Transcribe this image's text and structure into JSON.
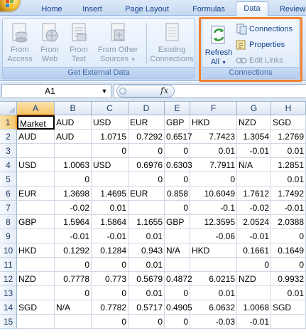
{
  "ribbon": {
    "tabs": [
      {
        "label": "Home",
        "active": false
      },
      {
        "label": "Insert",
        "active": false
      },
      {
        "label": "Page Layout",
        "active": false
      },
      {
        "label": "Formulas",
        "active": false
      },
      {
        "label": "Data",
        "active": true
      },
      {
        "label": "Review",
        "active": false
      }
    ],
    "get_external_data": {
      "label": "Get External Data",
      "from_access": [
        "From",
        "Access"
      ],
      "from_web": [
        "From",
        "Web"
      ],
      "from_text": [
        "From",
        "Text"
      ],
      "from_other_sources": [
        "From Other",
        "Sources"
      ],
      "existing_connections": [
        "Existing",
        "Connections"
      ]
    },
    "connections": {
      "label": "Connections",
      "refresh_all": [
        "Refresh",
        "All"
      ],
      "connections_btn": "Connections",
      "properties_btn": "Properties",
      "edit_links_btn": "Edit Links"
    }
  },
  "formula_bar": {
    "name_box": "A1",
    "fx_label": "fx",
    "formula": ""
  },
  "sheet": {
    "selected_cell": "A1",
    "columns": [
      "A",
      "B",
      "C",
      "D",
      "E",
      "F",
      "G",
      "H"
    ],
    "rows": [
      [
        "Market",
        "AUD",
        "USD",
        "EUR",
        "GBP",
        "HKD",
        "NZD",
        "SGD"
      ],
      [
        "AUD",
        "AUD",
        "1.0715",
        "0.7292",
        "0.6517",
        "7.7423",
        "1.3054",
        "1.2769"
      ],
      [
        "",
        "",
        "0",
        "0",
        "0",
        "0.01",
        "-0.01",
        "0.01"
      ],
      [
        "USD",
        "1.0063",
        "USD",
        "0.6976",
        "0.6303",
        "7.7911",
        "N/A",
        "1.2851"
      ],
      [
        "",
        "0",
        "",
        "0",
        "0",
        "0",
        "",
        "0.01"
      ],
      [
        "EUR",
        "1.3698",
        "1.4695",
        "EUR",
        "0.858",
        "10.6049",
        "1.7612",
        "1.7492"
      ],
      [
        "",
        "-0.02",
        "0.01",
        "",
        "0",
        "-0.1",
        "-0.02",
        "-0.01"
      ],
      [
        "GBP",
        "1.5964",
        "1.5864",
        "1.1655",
        "GBP",
        "12.3595",
        "2.0524",
        "2.0388"
      ],
      [
        "",
        "-0.01",
        "-0.01",
        "0.01",
        "",
        "-0.06",
        "-0.01",
        "0"
      ],
      [
        "HKD",
        "0.1292",
        "0.1284",
        "0.943",
        "N/A",
        "HKD",
        "0.1661",
        "0.1649"
      ],
      [
        "",
        "0",
        "0",
        "0.01",
        "",
        "",
        "0",
        "0"
      ],
      [
        "NZD",
        "0.7778",
        "0.773",
        "0.5679",
        "0.4872",
        "6.0215",
        "NZD",
        "0.9932"
      ],
      [
        "",
        "0",
        "0",
        "0.01",
        "0",
        "0.01",
        "",
        "0.01"
      ],
      [
        "SGD",
        "N/A",
        "0.7782",
        "0.5717",
        "0.4905",
        "6.0632",
        "1.0068",
        "SGD"
      ],
      [
        "",
        "",
        "0",
        "0",
        "0",
        "-0.03",
        "-0.01",
        ""
      ]
    ]
  },
  "colors": {
    "highlight_outline": "#f08030",
    "selected_header": "#f5c76b"
  }
}
